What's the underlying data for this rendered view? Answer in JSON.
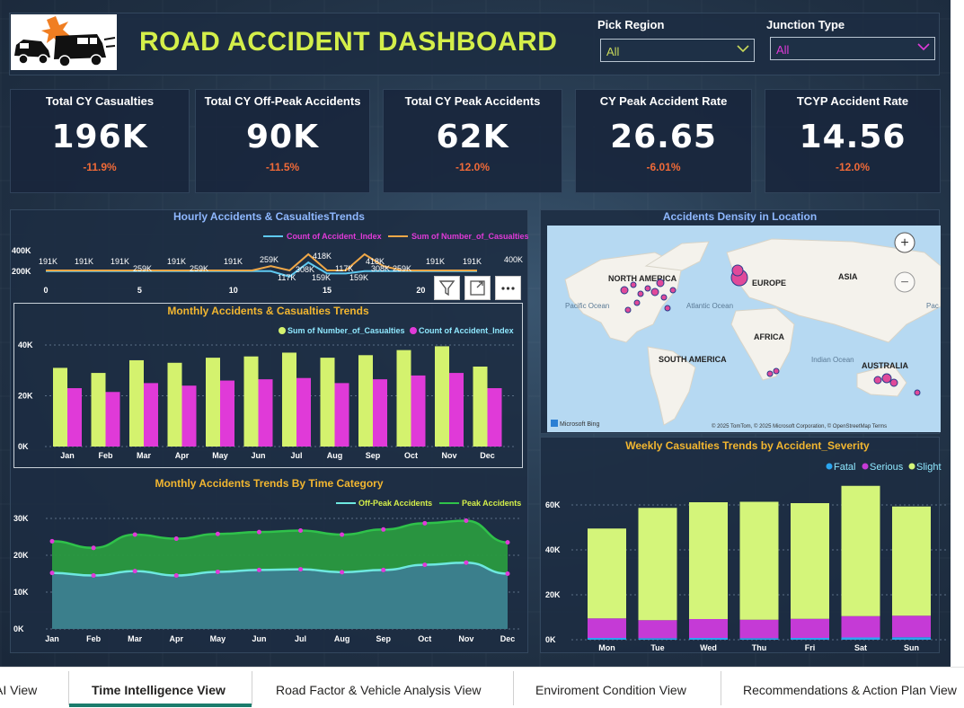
{
  "header": {
    "title": "ROAD ACCIDENT DASHBOARD"
  },
  "filters": {
    "region": {
      "label": "Pick Region",
      "value": "All"
    },
    "junction": {
      "label": "Junction Type",
      "value": "All"
    }
  },
  "kpis": [
    {
      "title": "Total CY Casualties",
      "value": "196K",
      "change": "-11.9%"
    },
    {
      "title": "Total CY Off-Peak Accidents",
      "value": "90K",
      "change": "-11.5%"
    },
    {
      "title": "Total CY Peak Accidents",
      "value": "62K",
      "change": "-12.0%"
    },
    {
      "title": "CY Peak Accident Rate",
      "value": "26.65",
      "change": "-6.01%"
    },
    {
      "title": "TCYP Accident Rate",
      "value": "14.56",
      "change": "-12.0%"
    }
  ],
  "hourly": {
    "title": "Hourly Accidents & CasualtiesTrends",
    "legend": [
      "Count of Accident_Index",
      "Sum of Number_of_Casualties"
    ],
    "colors": [
      "#5fc9f0",
      "#f0a848"
    ],
    "y_ticks": [
      "400K",
      "200K"
    ],
    "x_ticks": [
      "0",
      "5",
      "10",
      "15",
      "20"
    ],
    "labels_top": [
      "191K",
      "191K",
      "191K",
      "259K",
      "191K",
      "259K",
      "191K",
      "259K",
      "418K",
      "117K",
      "418K",
      "308K",
      "259K",
      "191K",
      "191K",
      "400K"
    ],
    "labels_bottom": [
      "117K",
      "308K",
      "159K",
      "159K"
    ]
  },
  "monthly": {
    "title": "Monthly Accidents & Casualties Trends",
    "legend": [
      "Sum of Number_of_Casualties",
      "Count of Accident_Index"
    ],
    "colors": [
      "#d4f26e",
      "#e03ad8"
    ],
    "y_ticks": [
      "40K",
      "20K",
      "0K"
    ]
  },
  "time_category": {
    "title": "Monthly Accidents Trends By Time Category",
    "legend": [
      "Off-Peak Accidents",
      "Peak Accidents"
    ],
    "colors": [
      "#6ee8e0",
      "#2fc24a"
    ],
    "y_ticks": [
      "30K",
      "20K",
      "10K",
      "0K"
    ]
  },
  "map": {
    "title": "Accidents Density in Location",
    "labels": [
      "NORTH AMERICA",
      "EUROPE",
      "ASIA",
      "AFRICA",
      "SOUTH AMERICA",
      "AUSTRALIA",
      "Pacific Ocean",
      "Atlantic Ocean",
      "Indian Ocean",
      "Pac Oce"
    ],
    "brand": "Microsoft Bing",
    "attribution": "© 2025 TomTom, © 2025 Microsoft Corporation, © OpenStreetMap  Terms",
    "zoom_in": "+",
    "zoom_out": "−"
  },
  "weekly": {
    "title": "Weekly Casualties Trends by Accident_Severity",
    "legend": [
      "Fatal",
      "Serious",
      "Slight"
    ],
    "colors": [
      "#2aa6f0",
      "#c53ad6",
      "#d4f57a"
    ],
    "y_ticks": [
      "60K",
      "40K",
      "20K",
      "0K"
    ]
  },
  "chart_data": [
    {
      "type": "bar",
      "title": "Monthly Accidents & Casualties Trends",
      "categories": [
        "Jan",
        "Feb",
        "Mar",
        "Apr",
        "May",
        "Jun",
        "Jul",
        "Aug",
        "Sep",
        "Oct",
        "Nov",
        "Dec"
      ],
      "ylim": [
        0,
        45000
      ],
      "series": [
        {
          "name": "Sum of Number_of_Casualties",
          "values": [
            31000,
            29000,
            34000,
            33000,
            35000,
            35500,
            37000,
            35000,
            36000,
            38000,
            39500,
            31500
          ]
        },
        {
          "name": "Count of Accident_Index",
          "values": [
            23000,
            21500,
            25000,
            24000,
            26000,
            26500,
            27000,
            25000,
            26500,
            28000,
            29000,
            23000
          ]
        }
      ]
    },
    {
      "type": "area",
      "title": "Monthly Accidents Trends By Time Category",
      "categories": [
        "Jan",
        "Feb",
        "Mar",
        "Apr",
        "May",
        "Jun",
        "Jul",
        "Aug",
        "Sep",
        "Oct",
        "Nov",
        "Dec"
      ],
      "ylim": [
        0,
        30000
      ],
      "series": [
        {
          "name": "Off-Peak Accidents",
          "values": [
            15200,
            14500,
            15700,
            14500,
            15500,
            16000,
            16200,
            15400,
            16000,
            17400,
            18000,
            15000
          ]
        },
        {
          "name": "Peak Accidents",
          "values": [
            23800,
            22000,
            25600,
            24500,
            25800,
            26300,
            26700,
            25600,
            27000,
            28700,
            29400,
            23500
          ]
        }
      ]
    },
    {
      "type": "bar",
      "title": "Weekly Casualties Trends by Accident_Severity",
      "categories": [
        "Mon",
        "Tue",
        "Wed",
        "Thu",
        "Fri",
        "Sat",
        "Sun"
      ],
      "ylim": [
        0,
        70000
      ],
      "series": [
        {
          "name": "Fatal",
          "values": [
            800,
            700,
            800,
            700,
            800,
            1000,
            1100
          ]
        },
        {
          "name": "Serious",
          "values": [
            8700,
            8000,
            8400,
            8200,
            8500,
            9500,
            9600
          ]
        },
        {
          "name": "Slight",
          "values": [
            40000,
            50000,
            52000,
            52500,
            51500,
            58000,
            48600
          ]
        }
      ]
    },
    {
      "type": "line",
      "title": "Hourly Accidents & CasualtiesTrends",
      "x": [
        0,
        1,
        2,
        3,
        4,
        5,
        6,
        7,
        8,
        9,
        10,
        11,
        12,
        13,
        14,
        15,
        16,
        17,
        18,
        19,
        20,
        21,
        22,
        23
      ],
      "series": [
        {
          "name": "Count of Accident_Index",
          "values": [
            191000,
            191000,
            191000,
            191000,
            191000,
            191000,
            191000,
            191000,
            191000,
            191000,
            191000,
            191000,
            191000,
            117000,
            308000,
            159000,
            159000,
            191000,
            191000,
            191000,
            191000,
            191000,
            191000,
            191000
          ]
        },
        {
          "name": "Sum of Number_of_Casualties",
          "values": [
            200000,
            200000,
            200000,
            200000,
            200000,
            200000,
            200000,
            200000,
            200000,
            200000,
            200000,
            200000,
            259000,
            200000,
            418000,
            200000,
            200000,
            418000,
            259000,
            200000,
            200000,
            200000,
            200000,
            200000
          ]
        }
      ]
    }
  ],
  "tabs": [
    "AI View",
    "Time Intelligence View",
    "Road Factor & Vehicle Analysis View",
    "Enviroment Condition View",
    "Recommendations & Action Plan View"
  ]
}
